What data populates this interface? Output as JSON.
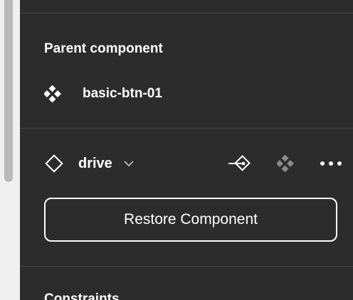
{
  "parent_section": {
    "title": "Parent component",
    "component_name": "basic-btn-01",
    "component_icon": "component-icon"
  },
  "instance_section": {
    "name": "drive",
    "instance_icon": "instance-diamond-icon",
    "dropdown_icon": "chevron-down-icon",
    "actions": [
      "go-to-main-component-icon",
      "component-icon",
      "more-options-icon"
    ],
    "restore_label": "Restore Component"
  },
  "next_section": {
    "title": "Constraints"
  },
  "colors": {
    "panel_bg": "#2c2c2c",
    "divider": "#444444",
    "text": "#ffffff",
    "muted_icon": "#8a8a8a"
  }
}
